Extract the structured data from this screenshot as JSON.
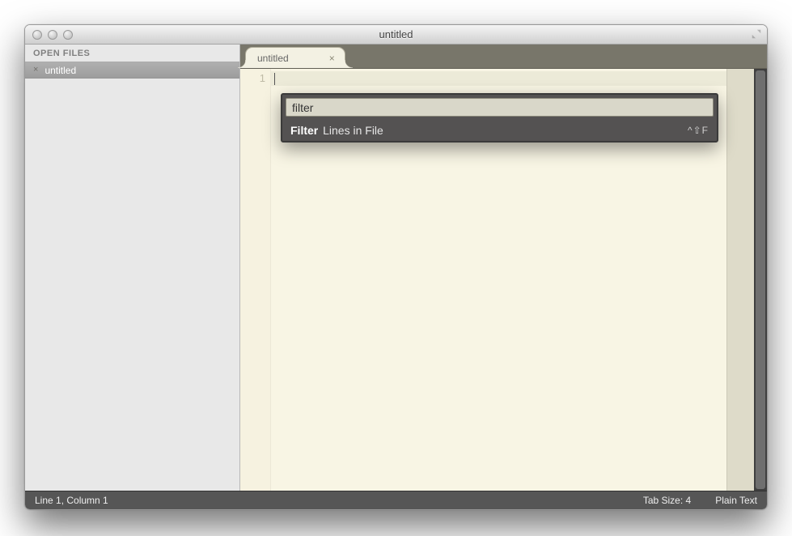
{
  "window": {
    "title": "untitled"
  },
  "sidebar": {
    "header": "OPEN FILES",
    "items": [
      {
        "label": "untitled"
      }
    ]
  },
  "tabs": [
    {
      "label": "untitled"
    }
  ],
  "gutter": {
    "line1": "1"
  },
  "command_palette": {
    "input_value": "filter",
    "results": [
      {
        "match": "Filter",
        "rest": " Lines in File",
        "shortcut": "^⇧F"
      }
    ]
  },
  "status": {
    "position": "Line 1, Column 1",
    "tab_size": "Tab Size: 4",
    "syntax": "Plain Text"
  }
}
